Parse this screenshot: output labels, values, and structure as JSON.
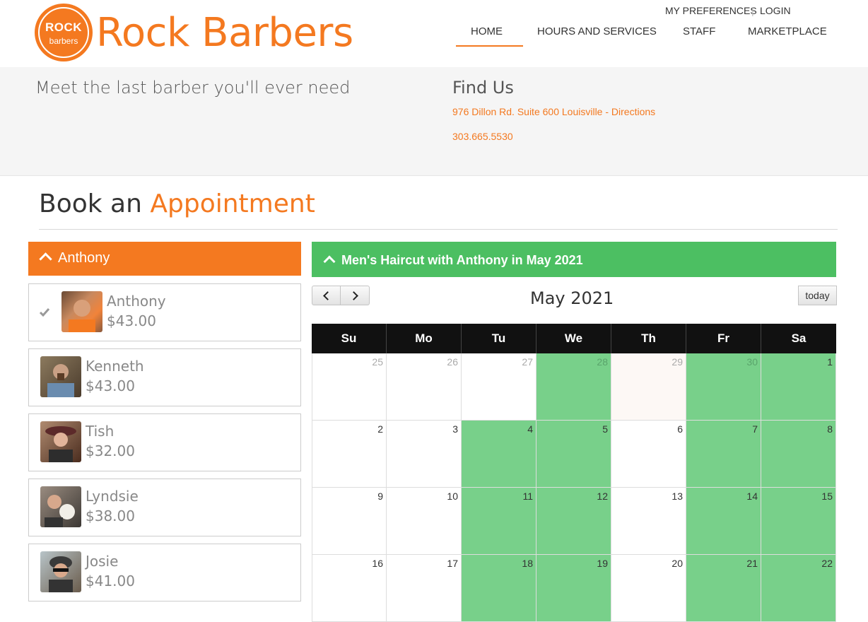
{
  "brand": {
    "logo_top": "ROCK",
    "logo_bottom": "barbers",
    "name": "Rock Barbers"
  },
  "top_links": {
    "preferences": "MY PREFERENCES",
    "separator": "|",
    "login": "LOGIN"
  },
  "nav": [
    {
      "label": "HOME",
      "active": true
    },
    {
      "label": "HOURS AND SERVICES",
      "active": false
    },
    {
      "label": "STAFF",
      "active": false
    },
    {
      "label": "MARKETPLACE",
      "active": false
    }
  ],
  "info": {
    "tagline": "Meet the last barber you'll ever need",
    "find_title": "Find Us",
    "address": "976 Dillon Rd. Suite 600 Louisville - Directions",
    "phone": "303.665.5530"
  },
  "booking": {
    "title_plain": "Book an",
    "title_accent": "Appointment"
  },
  "staff_panel": {
    "header": "Anthony",
    "members": [
      {
        "name": "Anthony",
        "price": "$43.00",
        "selected": true
      },
      {
        "name": "Kenneth",
        "price": "$43.00",
        "selected": false
      },
      {
        "name": "Tish",
        "price": "$32.00",
        "selected": false
      },
      {
        "name": "Lyndsie",
        "price": "$38.00",
        "selected": false
      },
      {
        "name": "Josie",
        "price": "$41.00",
        "selected": false
      }
    ]
  },
  "calendar": {
    "header": "Men's Haircut with Anthony in May 2021",
    "month_label": "May 2021",
    "today_label": "today",
    "weekdays": [
      "Su",
      "Mo",
      "Tu",
      "We",
      "Th",
      "Fr",
      "Sa"
    ],
    "weeks": [
      [
        {
          "d": "25",
          "other": true,
          "avail": false
        },
        {
          "d": "26",
          "other": true,
          "avail": false
        },
        {
          "d": "27",
          "other": true,
          "avail": false
        },
        {
          "d": "28",
          "other": true,
          "avail": true
        },
        {
          "d": "29",
          "other": true,
          "avail": false,
          "today": true
        },
        {
          "d": "30",
          "other": true,
          "avail": true
        },
        {
          "d": "1",
          "other": false,
          "avail": true
        }
      ],
      [
        {
          "d": "2",
          "other": false,
          "avail": false
        },
        {
          "d": "3",
          "other": false,
          "avail": false
        },
        {
          "d": "4",
          "other": false,
          "avail": true
        },
        {
          "d": "5",
          "other": false,
          "avail": true
        },
        {
          "d": "6",
          "other": false,
          "avail": false
        },
        {
          "d": "7",
          "other": false,
          "avail": true
        },
        {
          "d": "8",
          "other": false,
          "avail": true
        }
      ],
      [
        {
          "d": "9",
          "other": false,
          "avail": false
        },
        {
          "d": "10",
          "other": false,
          "avail": false
        },
        {
          "d": "11",
          "other": false,
          "avail": true
        },
        {
          "d": "12",
          "other": false,
          "avail": true
        },
        {
          "d": "13",
          "other": false,
          "avail": false
        },
        {
          "d": "14",
          "other": false,
          "avail": true
        },
        {
          "d": "15",
          "other": false,
          "avail": true
        }
      ],
      [
        {
          "d": "16",
          "other": false,
          "avail": false
        },
        {
          "d": "17",
          "other": false,
          "avail": false
        },
        {
          "d": "18",
          "other": false,
          "avail": true
        },
        {
          "d": "19",
          "other": false,
          "avail": true
        },
        {
          "d": "20",
          "other": false,
          "avail": false
        },
        {
          "d": "21",
          "other": false,
          "avail": true
        },
        {
          "d": "22",
          "other": false,
          "avail": true
        }
      ]
    ]
  },
  "colors": {
    "accent": "#f47920",
    "available": "#78d08a",
    "calendar_header": "#4cbf62"
  }
}
